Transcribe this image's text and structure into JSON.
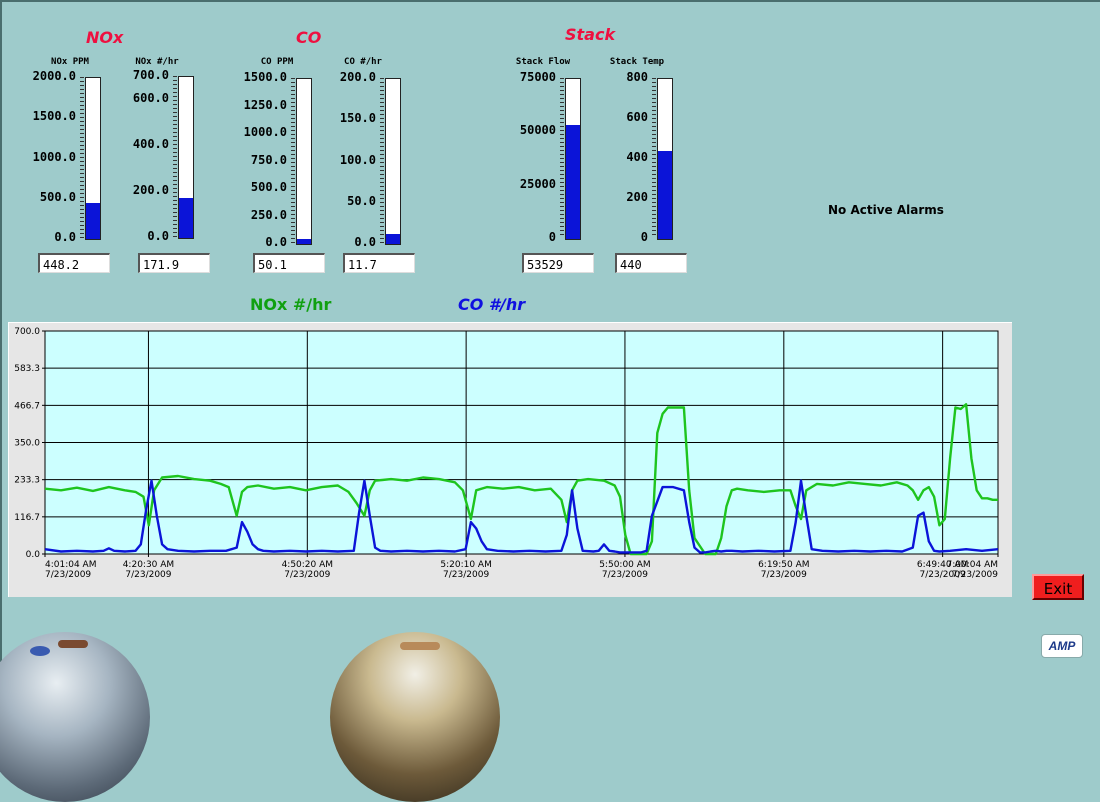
{
  "groups": {
    "nox_title": "NOx",
    "co_title": "CO",
    "stack_title": "Stack"
  },
  "gauges": [
    {
      "id": "nox-ppm",
      "label": "NOx PPM",
      "value": 448.2,
      "readout": "448.2",
      "max": 2000,
      "ticks": [
        "2000.0",
        "1500.0",
        "1000.0",
        "500.0",
        "0.0"
      ]
    },
    {
      "id": "nox-lbhr",
      "label": "NOx #/hr",
      "value": 171.9,
      "readout": "171.9",
      "max": 700,
      "ticks": [
        "700.0",
        "600.0",
        "400.0",
        "200.0",
        "0.0"
      ],
      "tick_values": [
        700,
        600,
        400,
        200,
        0
      ]
    },
    {
      "id": "co-ppm",
      "label": "CO PPM",
      "value": 50.1,
      "readout": "50.1",
      "max": 1500,
      "ticks": [
        "1500.0",
        "1250.0",
        "1000.0",
        "750.0",
        "500.0",
        "250.0",
        "0.0"
      ]
    },
    {
      "id": "co-lbhr",
      "label": "CO #/hr",
      "value": 11.7,
      "readout": "11.7",
      "max": 200,
      "ticks": [
        "200.0",
        "150.0",
        "100.0",
        "50.0",
        "0.0"
      ]
    },
    {
      "id": "stack-flow",
      "label": "Stack Flow",
      "value": 53529,
      "readout": "53529",
      "max": 75000,
      "ticks": [
        "75000",
        "50000",
        "25000",
        "0"
      ]
    },
    {
      "id": "stack-temp",
      "label": "Stack Temp",
      "value": 440,
      "readout": "440",
      "max": 800,
      "ticks": [
        "800",
        "600",
        "400",
        "200",
        "0"
      ]
    }
  ],
  "alarm_status": "No Active Alarms",
  "legend": {
    "nox": "NOx #/hr",
    "co": "CO #/hr"
  },
  "colors": {
    "nox_series": "#1ec41e",
    "co_series": "#0b14d8",
    "plot_bg": "#ccffff",
    "bar_fill": "#0b14d8",
    "group_title": "#ee1040"
  },
  "buttons": {
    "exit_label": "Exit"
  },
  "logo_text": "AMP",
  "chart_data": {
    "type": "line",
    "title": "",
    "xlabel": "",
    "ylabel": "",
    "ylim": [
      0,
      700
    ],
    "y_ticks": [
      "700.0",
      "583.3",
      "466.7",
      "350.0",
      "233.3",
      "116.7",
      "0.0"
    ],
    "y_tick_values": [
      700,
      583.3,
      466.7,
      350,
      233.3,
      116.7,
      0
    ],
    "x_range_minutes": [
      0,
      179
    ],
    "x_ticks": [
      {
        "time": "4:01:04 AM",
        "date": "7/23/2009",
        "minute": 0,
        "align": "start"
      },
      {
        "time": "4:20:30 AM",
        "date": "7/23/2009",
        "minute": 19.43,
        "align": "middle"
      },
      {
        "time": "4:50:20 AM",
        "date": "7/23/2009",
        "minute": 49.27,
        "align": "middle"
      },
      {
        "time": "5:20:10 AM",
        "date": "7/23/2009",
        "minute": 79.1,
        "align": "middle"
      },
      {
        "time": "5:50:00 AM",
        "date": "7/23/2009",
        "minute": 108.93,
        "align": "middle"
      },
      {
        "time": "6:19:50 AM",
        "date": "7/23/2009",
        "minute": 138.77,
        "align": "middle"
      },
      {
        "time": "6:49:40 AM",
        "date": "7/23/2009",
        "minute": 168.6,
        "align": "middle"
      },
      {
        "time": "7:00:04 AM",
        "date": "7/23/2009",
        "minute": 179,
        "align": "end"
      }
    ],
    "grid": true,
    "series": [
      {
        "name": "NOx #/hr",
        "color": "#1ec41e",
        "x": [
          0,
          3,
          6,
          9,
          12,
          15,
          17,
          18.5,
          19.5,
          20.5,
          22,
          25,
          28,
          31,
          33,
          34.5,
          36,
          37,
          38,
          40,
          43,
          46,
          49,
          52,
          55,
          57,
          58.5,
          60,
          61,
          62,
          65,
          68,
          71,
          74,
          77,
          78.5,
          80,
          81,
          83,
          86,
          89,
          92,
          95,
          97,
          98,
          99,
          100,
          102,
          105,
          107,
          108,
          109,
          110,
          112,
          113,
          114,
          115,
          116,
          117,
          118,
          119,
          120,
          121,
          122,
          124,
          125,
          126,
          127,
          128,
          129,
          130,
          132,
          135,
          138,
          140,
          141,
          142,
          143,
          145,
          148,
          151,
          154,
          157,
          160,
          162,
          163,
          164,
          165,
          166,
          167,
          168,
          169,
          170,
          171,
          172,
          173,
          174,
          175,
          176,
          177,
          178,
          179
        ],
        "y": [
          205,
          200,
          208,
          198,
          210,
          200,
          195,
          180,
          90,
          200,
          240,
          245,
          235,
          230,
          220,
          210,
          120,
          195,
          210,
          215,
          205,
          210,
          200,
          210,
          215,
          195,
          160,
          120,
          200,
          230,
          235,
          230,
          240,
          235,
          225,
          200,
          110,
          200,
          210,
          205,
          210,
          200,
          205,
          170,
          100,
          200,
          230,
          235,
          230,
          215,
          180,
          60,
          0,
          0,
          0,
          40,
          380,
          440,
          460,
          460,
          460,
          460,
          200,
          50,
          0,
          0,
          0,
          50,
          150,
          200,
          205,
          200,
          195,
          200,
          200,
          150,
          110,
          200,
          220,
          215,
          225,
          220,
          215,
          225,
          215,
          200,
          170,
          200,
          210,
          180,
          90,
          110,
          300,
          460,
          455,
          470,
          300,
          200,
          175,
          175,
          170,
          170
        ],
        "smooth_sharp": true
      },
      {
        "name": "CO #/hr",
        "color": "#0b14d8",
        "x": [
          0,
          3,
          6,
          9,
          11,
          12,
          13,
          15,
          17,
          18,
          19,
          20,
          21,
          22,
          23,
          25,
          28,
          31,
          34,
          36,
          37,
          38,
          39,
          40,
          41,
          43,
          46,
          49,
          52,
          55,
          58,
          59,
          60,
          61,
          62,
          63,
          65,
          68,
          71,
          74,
          77,
          79,
          80,
          81,
          82,
          83,
          85,
          88,
          91,
          94,
          97,
          98,
          99,
          100,
          101,
          103,
          104,
          105,
          106,
          107,
          108,
          110,
          112,
          113,
          114,
          116,
          118,
          120,
          121,
          122,
          123,
          124,
          125,
          126,
          127,
          128,
          129,
          131,
          134,
          137,
          140,
          141,
          142,
          143,
          144,
          146,
          149,
          152,
          155,
          158,
          161,
          163,
          164,
          165,
          166,
          167,
          168,
          170,
          173,
          176,
          179
        ],
        "y": [
          15,
          8,
          10,
          8,
          10,
          18,
          10,
          8,
          10,
          30,
          140,
          230,
          120,
          30,
          15,
          10,
          8,
          10,
          10,
          20,
          100,
          70,
          30,
          15,
          10,
          8,
          10,
          8,
          10,
          8,
          10,
          130,
          230,
          120,
          20,
          10,
          8,
          10,
          8,
          10,
          8,
          15,
          100,
          80,
          40,
          15,
          10,
          8,
          10,
          8,
          10,
          60,
          200,
          80,
          10,
          8,
          10,
          30,
          10,
          8,
          5,
          5,
          5,
          10,
          120,
          210,
          210,
          200,
          100,
          20,
          5,
          5,
          8,
          10,
          8,
          10,
          10,
          8,
          10,
          8,
          10,
          100,
          230,
          120,
          15,
          10,
          8,
          10,
          8,
          10,
          8,
          20,
          120,
          130,
          40,
          10,
          8,
          10,
          15,
          10,
          15
        ]
      }
    ]
  }
}
